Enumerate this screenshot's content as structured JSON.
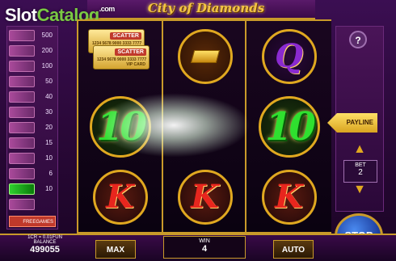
{
  "brand": {
    "watermark_a": "Slot",
    "watermark_b": "Catalog",
    "watermark_c": ".com"
  },
  "game": {
    "title": "City of Diamonds"
  },
  "paytable": [
    {
      "value": "500",
      "active": false
    },
    {
      "value": "200",
      "active": false
    },
    {
      "value": "100",
      "active": false
    },
    {
      "value": "50",
      "active": false
    },
    {
      "value": "40",
      "active": false
    },
    {
      "value": "30",
      "active": false
    },
    {
      "value": "20",
      "active": false
    },
    {
      "value": "15",
      "active": false
    },
    {
      "value": "10",
      "active": false
    },
    {
      "value": "6",
      "active": false
    },
    {
      "value": "10",
      "active": true
    },
    {
      "value": "",
      "active": false
    }
  ],
  "paytable_free_label": "FREEGAMES",
  "reels": {
    "scatter_tag": "SCATTER",
    "scatter_num": "1234 5678 9000 3333 7777",
    "scatter_vip": "VIP CARD",
    "q_symbol": "Q",
    "ten_symbol": "10",
    "k_symbol": "K"
  },
  "side": {
    "help": "?",
    "payline": "PAYLINE",
    "bet_label": "BET",
    "bet_value": "2",
    "bet_up": "▲",
    "bet_down": "▼",
    "stop": "STOP"
  },
  "bottom": {
    "credit_rate": "1CR = 0.01FUN",
    "balance_label": "BALANCE",
    "balance_value": "499055",
    "max_label": "MAX",
    "win_label": "WIN",
    "win_value": "4",
    "auto_label": "AUTO"
  },
  "colors": {
    "gold": "#c99a2a",
    "green": "#2fe02f",
    "red": "#e8261e",
    "purple": "#8a2ad0",
    "blue": "#1a3a9a"
  }
}
